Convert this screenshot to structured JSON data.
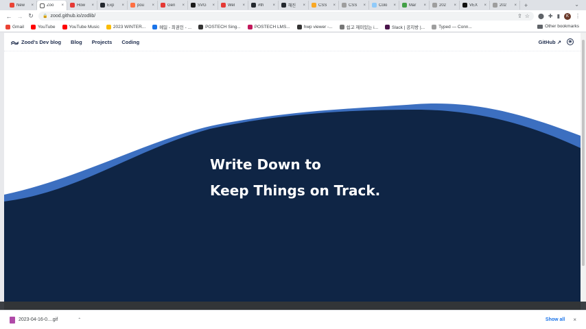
{
  "browser": {
    "tabs": [
      {
        "title": "New",
        "color": "#ea4335"
      },
      {
        "title": "Zoo",
        "color": "#ffffff",
        "active": true
      },
      {
        "title": "How",
        "color": "#e53935"
      },
      {
        "title": "Exp",
        "color": "#24292f"
      },
      {
        "title": "pou",
        "color": "#ff7043"
      },
      {
        "title": "Gen",
        "color": "#e53935"
      },
      {
        "title": "SVG",
        "color": "#1a1a1a"
      },
      {
        "title": "Wel",
        "color": "#e53935"
      },
      {
        "title": "#th",
        "color": "#24292f"
      },
      {
        "title": "해진",
        "color": "#24292f"
      },
      {
        "title": "CSS",
        "color": "#f9a825"
      },
      {
        "title": "CSS",
        "color": "#9e9e9e"
      },
      {
        "title": "Colo",
        "color": "#90caf9"
      },
      {
        "title": "Mar",
        "color": "#43a047"
      },
      {
        "title": "202",
        "color": "#9e9e9e"
      },
      {
        "title": "VEX",
        "color": "#111111"
      },
      {
        "title": "202",
        "color": "#9e9e9e"
      }
    ],
    "new_tab_glyph": "+",
    "tab_menu_glyph": "⌄",
    "close_glyph": "×",
    "url": "zood.github.io/zodlib/",
    "bookmarks": [
      {
        "label": "Gmail",
        "color": "#ea4335"
      },
      {
        "label": "YouTube",
        "color": "#ff0000"
      },
      {
        "label": "YouTube Music",
        "color": "#ff0000"
      },
      {
        "label": "2023 WINTER...",
        "color": "#fbbc04"
      },
      {
        "label": "메일 - 최권인 - ...",
        "color": "#1a73e8"
      },
      {
        "label": "POSTECH Sing...",
        "color": "#333333"
      },
      {
        "label": "POSTECH LMS...",
        "color": "#c2185b"
      },
      {
        "label": "hwp viewer -...",
        "color": "#333333"
      },
      {
        "label": "쉽고 재미있는 i...",
        "color": "#777777"
      },
      {
        "label": "Slack | 공지방 |...",
        "color": "#4a154b"
      },
      {
        "label": "Typed — Conn...",
        "color": "#9e9e9e"
      }
    ],
    "other_bookmarks": "Other bookmarks"
  },
  "site": {
    "brand": "Zood's Dev blog",
    "nav": [
      "Blog",
      "Projects",
      "Coding"
    ],
    "github_label": "GitHub ↗",
    "theme_icon": "☀",
    "headline_line1": "Write Down to",
    "headline_line2": "Keep Things on Track.",
    "colors": {
      "wave_light": "#3c6fc0",
      "wave_dark": "#0f2545",
      "text": "#1f2d4d"
    }
  },
  "download": {
    "filename": "2023-04-16-0....gif",
    "show_all": "Show all",
    "close_glyph": "×"
  }
}
